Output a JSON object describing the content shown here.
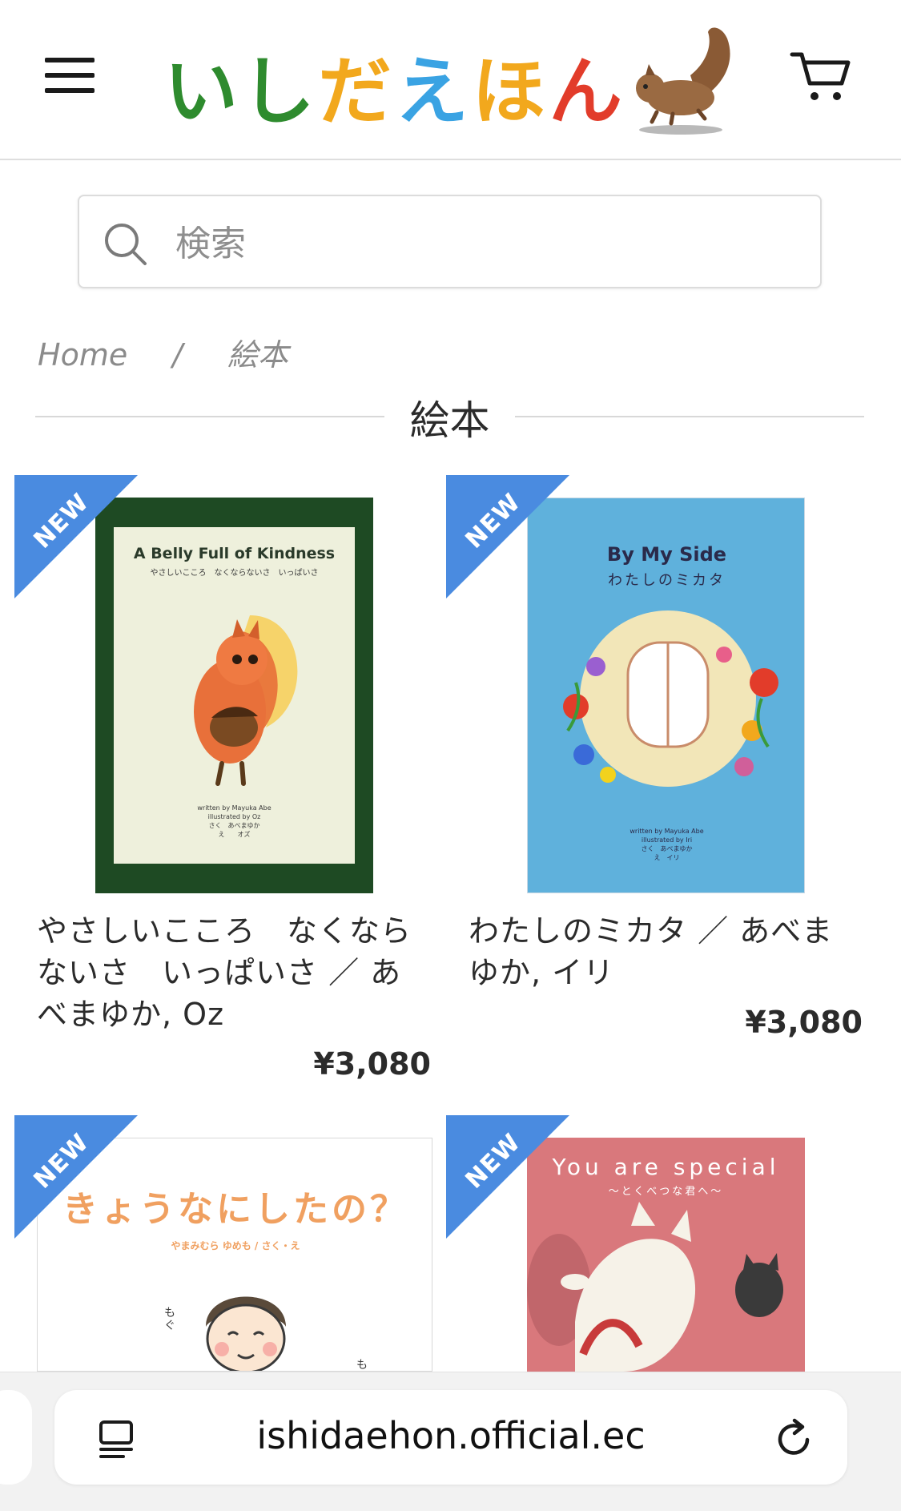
{
  "header": {
    "menu_icon": "hamburger-menu-icon",
    "logo_text": "いしだえほん",
    "logo_chars": [
      {
        "ch": "い",
        "color": "#2e8b2e"
      },
      {
        "ch": "し",
        "color": "#2e8b2e"
      },
      {
        "ch": "だ",
        "color": "#f2a81d"
      },
      {
        "ch": "え",
        "color": "#3aa3e3"
      },
      {
        "ch": "ほ",
        "color": "#f2a81d"
      },
      {
        "ch": "ん",
        "color": "#e23c2a"
      }
    ],
    "logo_mascot": "squirrel",
    "cart_icon": "shopping-cart-icon"
  },
  "search": {
    "placeholder": "検索",
    "value": "",
    "icon": "search-icon"
  },
  "breadcrumb": {
    "home": "Home",
    "separator": "/",
    "current": "絵本"
  },
  "page_title": "絵本",
  "products": [
    {
      "badge": "NEW",
      "cover_title": "A Belly Full of Kindness",
      "cover_subtitle": "やさしいこころ　なくならないさ　いっぱいさ",
      "cover_credits": [
        "written by Mayuka Abe",
        "illustrated by Oz",
        "さく　あべまゆか",
        "え　　オズ"
      ],
      "name_lines": [
        "やさしいこころ　なくなら",
        "ないさ　いっぱいさ ／ あ",
        "べまゆか, Oz"
      ],
      "price": "¥3,080"
    },
    {
      "badge": "NEW",
      "cover_title": "By My Side",
      "cover_subtitle": "わたしのミカタ",
      "cover_credits": [
        "written by Mayuka Abe",
        "illustrated by Iri",
        "さく　あべまゆか",
        "え　イリ"
      ],
      "name_lines": [
        "わたしのミカタ ／ あべま",
        "ゆか, イリ"
      ],
      "price": "¥3,080"
    },
    {
      "badge": "NEW",
      "cover_title": "きょうなにしたの？",
      "cover_subtitle": "やまみむら ゆめも / さく・え",
      "cover_small": [
        "もぐ",
        "も"
      ],
      "name_lines": [],
      "price": ""
    },
    {
      "badge": "NEW",
      "cover_title": "You are special",
      "cover_subtitle": "〜とくべつな君へ〜",
      "name_lines": [],
      "price": ""
    }
  ],
  "browser": {
    "url": "ishidaehon.official.ec",
    "reader_icon": "reader-mode-icon",
    "reload_icon": "reload-icon"
  },
  "colors": {
    "ribbon": "#4a8be0",
    "cover1_frame": "#1e4a23",
    "cover2_bg": "#5fb1dc",
    "cover4_bg": "#d9787c"
  }
}
